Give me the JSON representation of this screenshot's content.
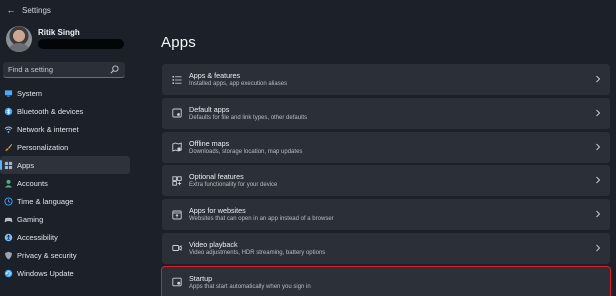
{
  "window": {
    "title": "Settings"
  },
  "user": {
    "name": "Ritik Singh"
  },
  "search": {
    "placeholder": "Find a setting"
  },
  "sidebar": {
    "items": [
      {
        "label": "System",
        "icon": "monitor-icon",
        "color": "#4aa8ff"
      },
      {
        "label": "Bluetooth & devices",
        "icon": "bluetooth-icon",
        "color": "#4aa8ff"
      },
      {
        "label": "Network & internet",
        "icon": "wifi-icon",
        "color": "#9fc8ff"
      },
      {
        "label": "Personalization",
        "icon": "brush-icon",
        "color": "#e5a45c"
      },
      {
        "label": "Apps",
        "icon": "apps-grid-icon",
        "color": "#9fb4cf",
        "active": true
      },
      {
        "label": "Accounts",
        "icon": "person-icon",
        "color": "#49b27d"
      },
      {
        "label": "Time & language",
        "icon": "globe-clock-icon",
        "color": "#4aa8ff"
      },
      {
        "label": "Gaming",
        "icon": "controller-icon",
        "color": "#b9bcc4"
      },
      {
        "label": "Accessibility",
        "icon": "accessibility-icon",
        "color": "#7cc0ff"
      },
      {
        "label": "Privacy & security",
        "icon": "shield-icon",
        "color": "#9aa3b1"
      },
      {
        "label": "Windows Update",
        "icon": "update-icon",
        "color": "#4aa8ff"
      }
    ]
  },
  "main": {
    "title": "Apps",
    "cards": [
      {
        "title": "Apps & features",
        "desc": "Installed apps, app execution aliases",
        "icon": "list-icon"
      },
      {
        "title": "Default apps",
        "desc": "Defaults for file and link types, other defaults",
        "icon": "default-apps-icon"
      },
      {
        "title": "Offline maps",
        "desc": "Downloads, storage location, map updates",
        "icon": "map-icon"
      },
      {
        "title": "Optional features",
        "desc": "Extra functionality for your device",
        "icon": "optional-features-icon"
      },
      {
        "title": "Apps for websites",
        "desc": "Websites that can open in an app instead of a browser",
        "icon": "web-apps-icon"
      },
      {
        "title": "Video playback",
        "desc": "Video adjustments, HDR streaming, battery options",
        "icon": "video-icon"
      },
      {
        "title": "Startup",
        "desc": "Apps that start automatically when you sign in",
        "icon": "startup-icon",
        "highlighted": true
      }
    ]
  },
  "colors": {
    "accent": "#5ab0ff",
    "highlight_border": "#d9202a",
    "background": "#1c2028",
    "card": "#2b2f37"
  }
}
